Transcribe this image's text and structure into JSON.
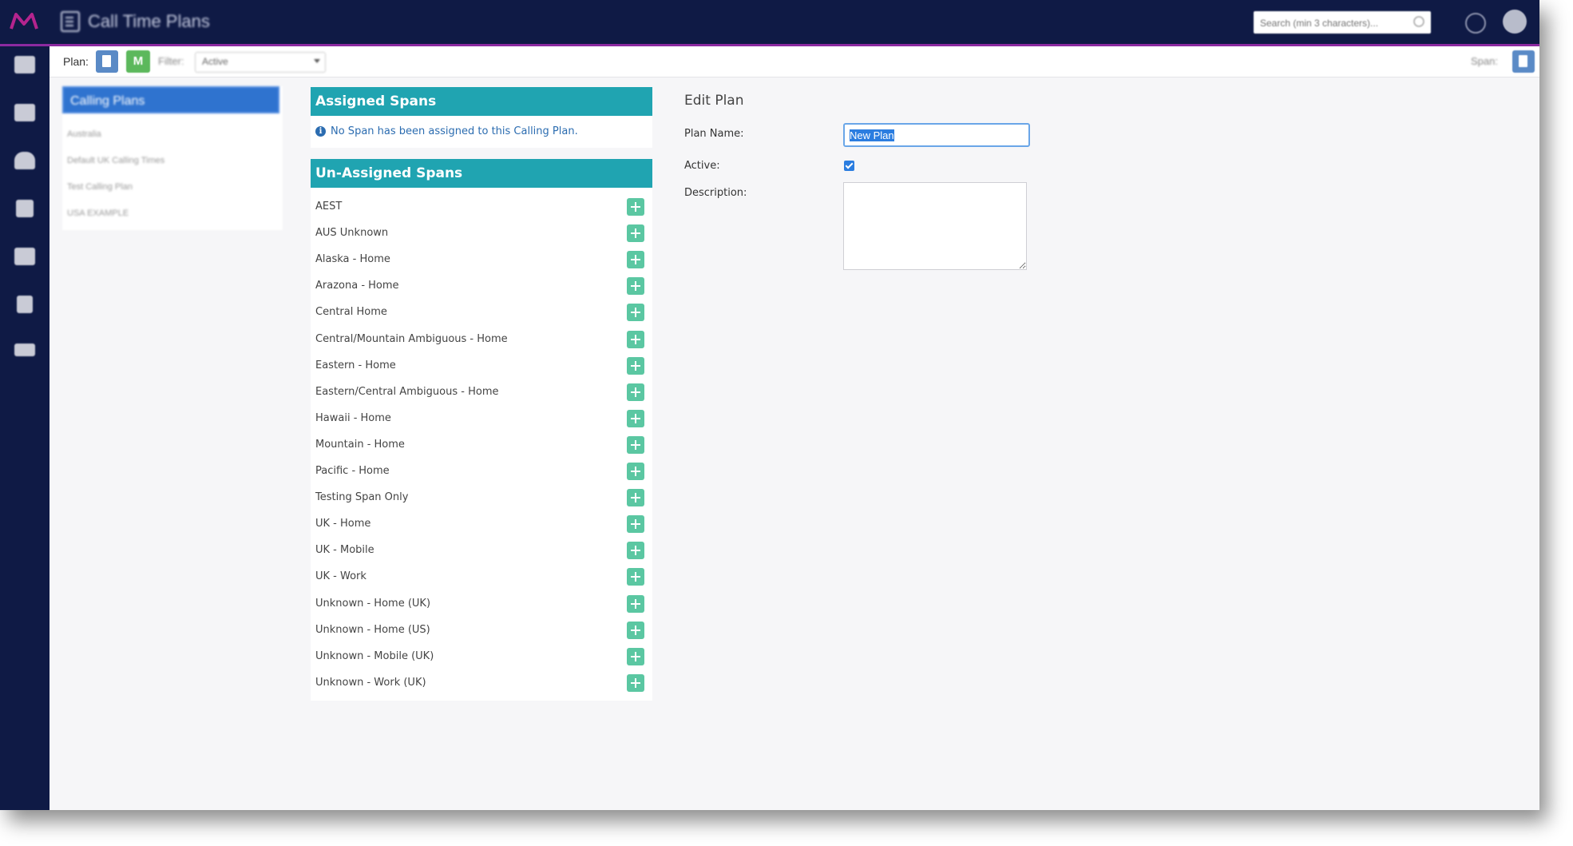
{
  "header": {
    "title": "Call Time Plans",
    "search_placeholder": "Search (min 3 characters)...",
    "colors": {
      "bg": "#0f1a45",
      "accent": "#8c2aa0"
    }
  },
  "toolbar": {
    "plan_label": "Plan:",
    "m_button_label": "M",
    "filter_label": "Filter:",
    "filter_value": "Active",
    "span_label": "Span:"
  },
  "calling_plans": {
    "title": "Calling Plans",
    "items": [
      "Australia",
      "Default UK Calling Times",
      "Test Calling Plan",
      "USA EXAMPLE"
    ]
  },
  "assigned_spans": {
    "title": "Assigned Spans",
    "info_message": "No Span has been assigned to this Calling Plan."
  },
  "unassigned_spans": {
    "title": "Un-Assigned Spans",
    "items": [
      "AEST",
      "AUS Unknown",
      "Alaska - Home",
      "Arazona - Home",
      "Central Home",
      "Central/Mountain Ambiguous - Home",
      "Eastern - Home",
      "Eastern/Central Ambiguous - Home",
      "Hawaii - Home",
      "Mountain - Home",
      "Pacific - Home",
      "Testing Span Only",
      "UK - Home",
      "UK - Mobile",
      "UK - Work",
      "Unknown - Home (UK)",
      "Unknown - Home (US)",
      "Unknown - Mobile (UK)",
      "Unknown - Work (UK)"
    ]
  },
  "edit_plan": {
    "title": "Edit Plan",
    "plan_name_label": "Plan Name:",
    "plan_name_value": "New Plan",
    "active_label": "Active:",
    "active_checked": true,
    "description_label": "Description:",
    "description_value": ""
  }
}
